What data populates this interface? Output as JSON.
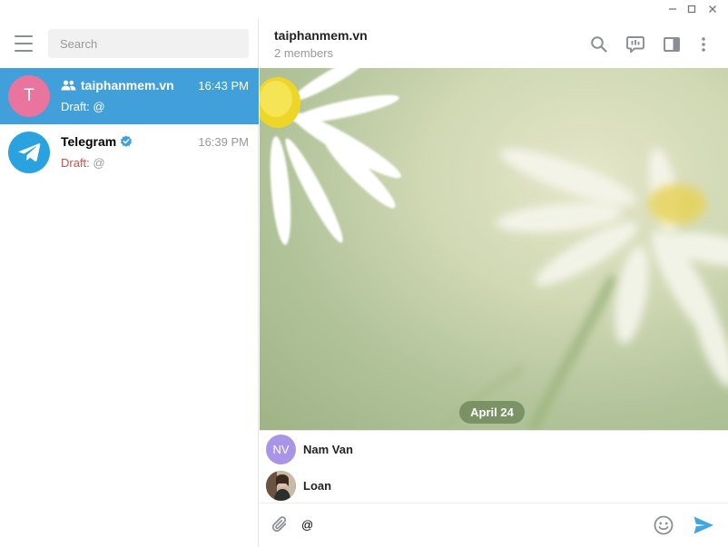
{
  "window": {
    "controls": [
      "minimize-icon",
      "maximize-icon",
      "close-icon"
    ]
  },
  "sidebar": {
    "menu_icon": "hamburger-menu-icon",
    "search_placeholder": "Search",
    "chats": [
      {
        "name": "taiphanmem.vn",
        "avatar_letter": "T",
        "avatar_color": "#e9749e",
        "type_icon": "group-icon",
        "time": "16:43 PM",
        "draft_label": "Draft:",
        "draft_text": "@",
        "active": true
      },
      {
        "name": "Telegram",
        "avatar_color": "#2aa2e0",
        "avatar_icon": "telegram-plane-icon",
        "verified_icon": "verified-badge-icon",
        "time": "16:39 PM",
        "draft_label": "Draft:",
        "draft_text": "@",
        "active": false
      }
    ]
  },
  "chat_header": {
    "title": "taiphanmem.vn",
    "status": "2 members",
    "icons": [
      "search-icon",
      "discussion-icon",
      "sidebar-toggle-icon",
      "more-vertical-icon"
    ]
  },
  "conversation": {
    "date_separator": "April 24",
    "wallpaper": "daisy-flowers-photo"
  },
  "mention_suggestions": [
    {
      "name": "Nam Van",
      "initials": "NV",
      "avatar_color": "#a995e6"
    },
    {
      "name": "Loan",
      "avatar": "photo-avatar"
    }
  ],
  "composer": {
    "value": "@",
    "icons": [
      "attach-icon",
      "emoji-icon",
      "send-icon"
    ]
  },
  "colors": {
    "accent": "#419fd9",
    "draft_red": "#d14e4e",
    "muted": "#999999"
  }
}
